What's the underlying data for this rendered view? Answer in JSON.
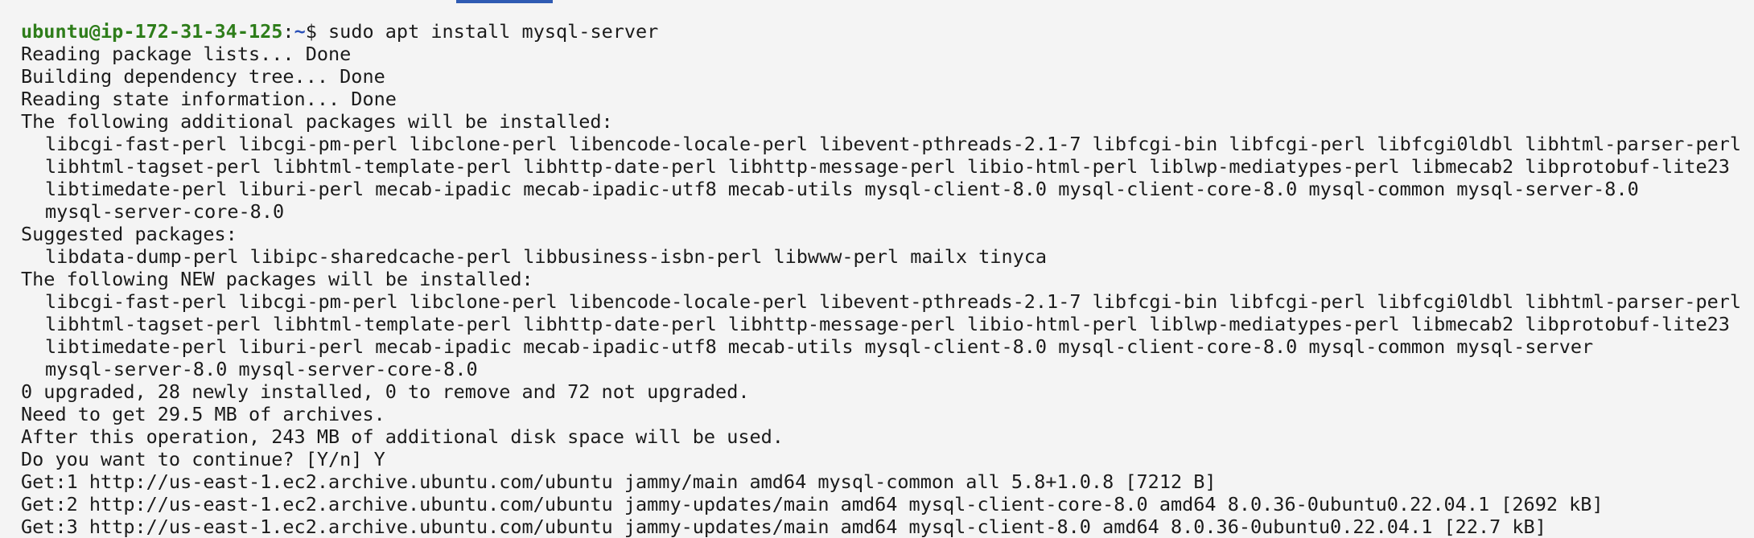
{
  "prompt": {
    "user_host": "ubuntu@ip-172-31-34-125",
    "sep": ":",
    "path": "~",
    "symbol": "$ ",
    "command": "sudo apt install mysql-server"
  },
  "output": {
    "reading_lists": "Reading package lists... Done",
    "building_tree": "Building dependency tree... Done",
    "reading_state": "Reading state information... Done",
    "additional_header": "The following additional packages will be installed:",
    "additional_lines": [
      "libcgi-fast-perl libcgi-pm-perl libclone-perl libencode-locale-perl libevent-pthreads-2.1-7 libfcgi-bin libfcgi-perl libfcgi0ldbl libhtml-parser-perl",
      "libhtml-tagset-perl libhtml-template-perl libhttp-date-perl libhttp-message-perl libio-html-perl liblwp-mediatypes-perl libmecab2 libprotobuf-lite23",
      "libtimedate-perl liburi-perl mecab-ipadic mecab-ipadic-utf8 mecab-utils mysql-client-8.0 mysql-client-core-8.0 mysql-common mysql-server-8.0",
      "mysql-server-core-8.0"
    ],
    "suggested_header": "Suggested packages:",
    "suggested_lines": [
      "libdata-dump-perl libipc-sharedcache-perl libbusiness-isbn-perl libwww-perl mailx tinyca"
    ],
    "new_header": "The following NEW packages will be installed:",
    "new_lines": [
      "libcgi-fast-perl libcgi-pm-perl libclone-perl libencode-locale-perl libevent-pthreads-2.1-7 libfcgi-bin libfcgi-perl libfcgi0ldbl libhtml-parser-perl",
      "libhtml-tagset-perl libhtml-template-perl libhttp-date-perl libhttp-message-perl libio-html-perl liblwp-mediatypes-perl libmecab2 libprotobuf-lite23",
      "libtimedate-perl liburi-perl mecab-ipadic mecab-ipadic-utf8 mecab-utils mysql-client-8.0 mysql-client-core-8.0 mysql-common mysql-server",
      "mysql-server-8.0 mysql-server-core-8.0"
    ],
    "summary": "0 upgraded, 28 newly installed, 0 to remove and 72 not upgraded.",
    "need_to_get": "Need to get 29.5 MB of archives.",
    "disk_space": "After this operation, 243 MB of additional disk space will be used.",
    "continue_prompt": "Do you want to continue? [Y/n] Y",
    "get_lines": [
      "Get:1 http://us-east-1.ec2.archive.ubuntu.com/ubuntu jammy/main amd64 mysql-common all 5.8+1.0.8 [7212 B]",
      "Get:2 http://us-east-1.ec2.archive.ubuntu.com/ubuntu jammy-updates/main amd64 mysql-client-core-8.0 amd64 8.0.36-0ubuntu0.22.04.1 [2692 kB]",
      "Get:3 http://us-east-1.ec2.archive.ubuntu.com/ubuntu jammy-updates/main amd64 mysql-client-8.0 amd64 8.0.36-0ubuntu0.22.04.1 [22.7 kB]"
    ]
  },
  "colors": {
    "background": "#f4f4f4",
    "text": "#1b1b1b",
    "prompt_user": "#2e7d1a",
    "prompt_path": "#2a50b8",
    "scroll_hint": "#2f5bb3"
  }
}
